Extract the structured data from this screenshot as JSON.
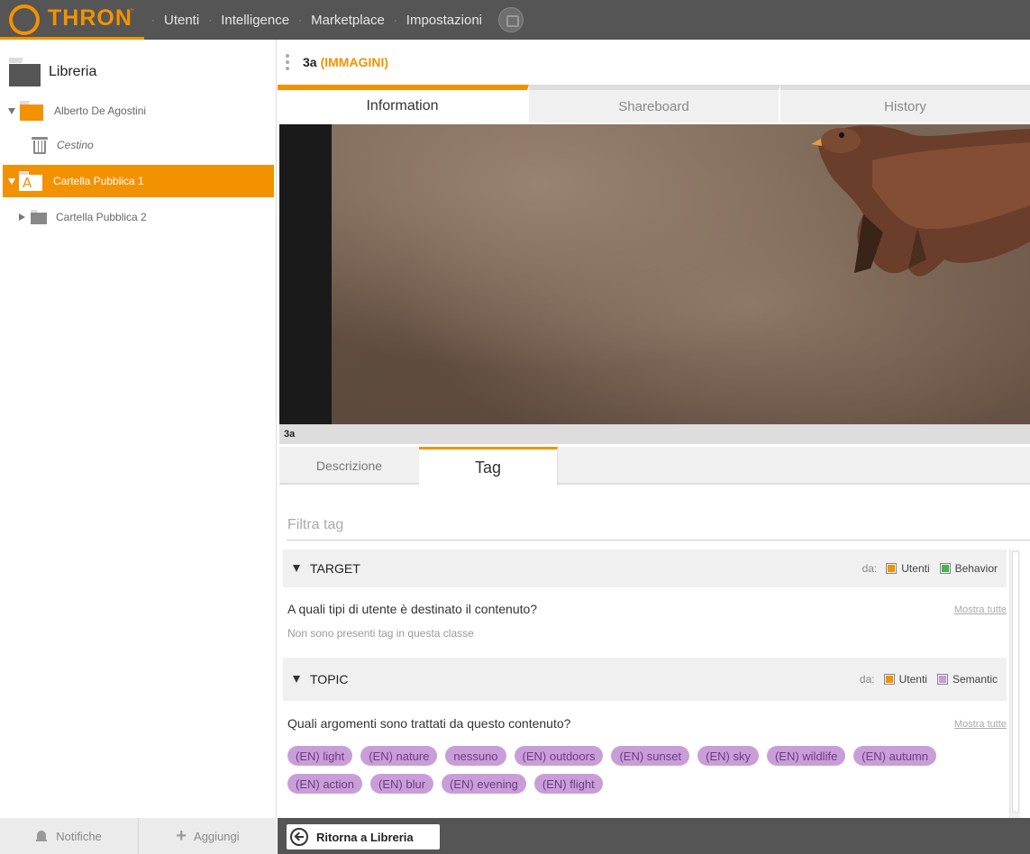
{
  "brand": {
    "name": "THRON",
    "trademark": "™",
    "accent": "#f39200"
  },
  "nav": {
    "items": [
      "Utenti",
      "Intelligence",
      "Marketplace",
      "Impostazioni"
    ],
    "separator": "·"
  },
  "sidebar": {
    "title": "Libreria",
    "tree": [
      {
        "label": "Alberto De Agostini",
        "icon": "folder-orange",
        "expanded": true
      },
      {
        "label": "Cestino",
        "icon": "trash-icon"
      },
      {
        "label": "Cartella Pubblica 1",
        "icon": "folder-public",
        "selected": true,
        "expanded": true
      },
      {
        "label": "Cartella Pubblica 2",
        "icon": "folder-grey",
        "expanded": false
      }
    ],
    "footer": {
      "notifications": "Notifiche",
      "add": "Aggiungi"
    }
  },
  "content": {
    "name": "3a",
    "type": "(IMMAGINI)"
  },
  "tabs": [
    "Information",
    "Shareboard",
    "History"
  ],
  "preview": {
    "caption": "3a"
  },
  "subtabs": {
    "description": "Descrizione",
    "tag": "Tag"
  },
  "filter": {
    "placeholder": "Filtra tag",
    "value": ""
  },
  "classes": {
    "target": {
      "title": "TARGET",
      "source_prefix": "da:",
      "sources": [
        "Utenti",
        "Behavior"
      ],
      "question": "A quali tipi di utente è destinato il contenuto?",
      "show_all": "Mostra tutte",
      "empty_text": "Non sono presenti tag in questa classe"
    },
    "topic": {
      "title": "TOPIC",
      "source_prefix": "da:",
      "sources": [
        "Utenti",
        "Semantic"
      ],
      "question": "Quali argomenti sono trattati da questo contenuto?",
      "show_all": "Mostra tutte",
      "tags": [
        "(EN) light",
        "(EN) nature",
        "nessuno",
        "(EN) outdoors",
        "(EN) sunset",
        "(EN) sky",
        "(EN) wildlife",
        "(EN) autumn",
        "(EN) action",
        "(EN) blur",
        "(EN) evening",
        "(EN) flight"
      ]
    }
  },
  "footer": {
    "back": "Ritorna a Libreria"
  },
  "colors": {
    "topbar": "#555555",
    "accent": "#f39200",
    "tag_bg": "#c99ed8",
    "tag_text": "#6b3b82",
    "source_users": "#f39200",
    "source_behavior": "#4caf50",
    "source_semantic": "#c89cd8"
  }
}
